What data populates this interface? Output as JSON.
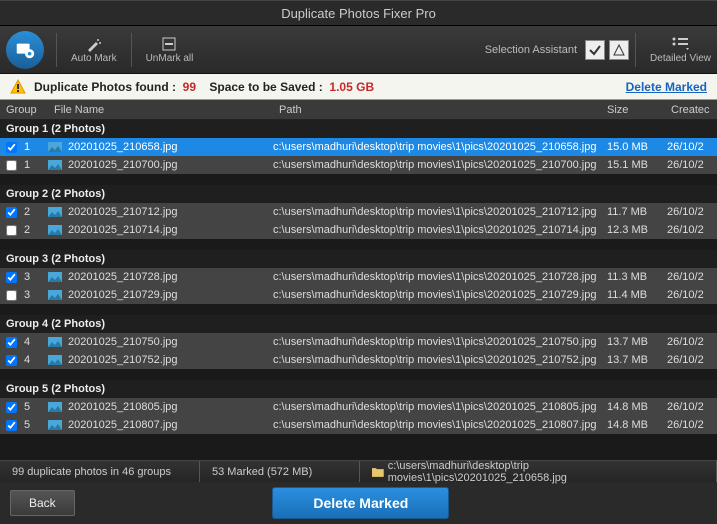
{
  "title": "Duplicate Photos Fixer Pro",
  "toolbar": {
    "auto_mark": "Auto Mark",
    "unmark_all": "UnMark all",
    "selection_assistant": "Selection Assistant",
    "detailed_view": "Detailed View"
  },
  "infobar": {
    "dup_label": "Duplicate Photos found :",
    "dup_count": "99",
    "space_label": "Space to be Saved :",
    "space_value": "1.05 GB",
    "delete_marked": "Delete Marked"
  },
  "columns": {
    "group": "Group",
    "file_name": "File Name",
    "path": "Path",
    "size": "Size",
    "created": "Createc"
  },
  "groups": [
    {
      "header": "Group 1  (2 Photos)",
      "rows": [
        {
          "checked": true,
          "selected": true,
          "num": "1",
          "name": "20201025_210658.jpg",
          "path": "c:\\users\\madhuri\\desktop\\trip movies\\1\\pics\\20201025_210658.jpg",
          "size": "15.0 MB",
          "date": "26/10/2"
        },
        {
          "checked": false,
          "selected": false,
          "num": "1",
          "name": "20201025_210700.jpg",
          "path": "c:\\users\\madhuri\\desktop\\trip movies\\1\\pics\\20201025_210700.jpg",
          "size": "15.1 MB",
          "date": "26/10/2"
        }
      ]
    },
    {
      "header": "Group 2  (2 Photos)",
      "rows": [
        {
          "checked": true,
          "selected": false,
          "num": "2",
          "name": "20201025_210712.jpg",
          "path": "c:\\users\\madhuri\\desktop\\trip movies\\1\\pics\\20201025_210712.jpg",
          "size": "11.7 MB",
          "date": "26/10/2"
        },
        {
          "checked": false,
          "selected": false,
          "num": "2",
          "name": "20201025_210714.jpg",
          "path": "c:\\users\\madhuri\\desktop\\trip movies\\1\\pics\\20201025_210714.jpg",
          "size": "12.3 MB",
          "date": "26/10/2"
        }
      ]
    },
    {
      "header": "Group 3  (2 Photos)",
      "rows": [
        {
          "checked": true,
          "selected": false,
          "num": "3",
          "name": "20201025_210728.jpg",
          "path": "c:\\users\\madhuri\\desktop\\trip movies\\1\\pics\\20201025_210728.jpg",
          "size": "11.3 MB",
          "date": "26/10/2"
        },
        {
          "checked": false,
          "selected": false,
          "num": "3",
          "name": "20201025_210729.jpg",
          "path": "c:\\users\\madhuri\\desktop\\trip movies\\1\\pics\\20201025_210729.jpg",
          "size": "11.4 MB",
          "date": "26/10/2"
        }
      ]
    },
    {
      "header": "Group 4  (2 Photos)",
      "rows": [
        {
          "checked": true,
          "selected": false,
          "num": "4",
          "name": "20201025_210750.jpg",
          "path": "c:\\users\\madhuri\\desktop\\trip movies\\1\\pics\\20201025_210750.jpg",
          "size": "13.7 MB",
          "date": "26/10/2"
        },
        {
          "checked": true,
          "selected": false,
          "num": "4",
          "name": "20201025_210752.jpg",
          "path": "c:\\users\\madhuri\\desktop\\trip movies\\1\\pics\\20201025_210752.jpg",
          "size": "13.7 MB",
          "date": "26/10/2"
        }
      ]
    },
    {
      "header": "Group 5  (2 Photos)",
      "rows": [
        {
          "checked": true,
          "selected": false,
          "num": "5",
          "name": "20201025_210805.jpg",
          "path": "c:\\users\\madhuri\\desktop\\trip movies\\1\\pics\\20201025_210805.jpg",
          "size": "14.8 MB",
          "date": "26/10/2"
        },
        {
          "checked": true,
          "selected": false,
          "num": "5",
          "name": "20201025_210807.jpg",
          "path": "c:\\users\\madhuri\\desktop\\trip movies\\1\\pics\\20201025_210807.jpg",
          "size": "14.8 MB",
          "date": "26/10/2"
        }
      ]
    }
  ],
  "status": {
    "summary": "99 duplicate photos in 46 groups",
    "marked": "53 Marked (572 MB)",
    "path": "c:\\users\\madhuri\\desktop\\trip movies\\1\\pics\\20201025_210658.jpg"
  },
  "footer": {
    "back": "Back",
    "delete": "Delete Marked"
  }
}
